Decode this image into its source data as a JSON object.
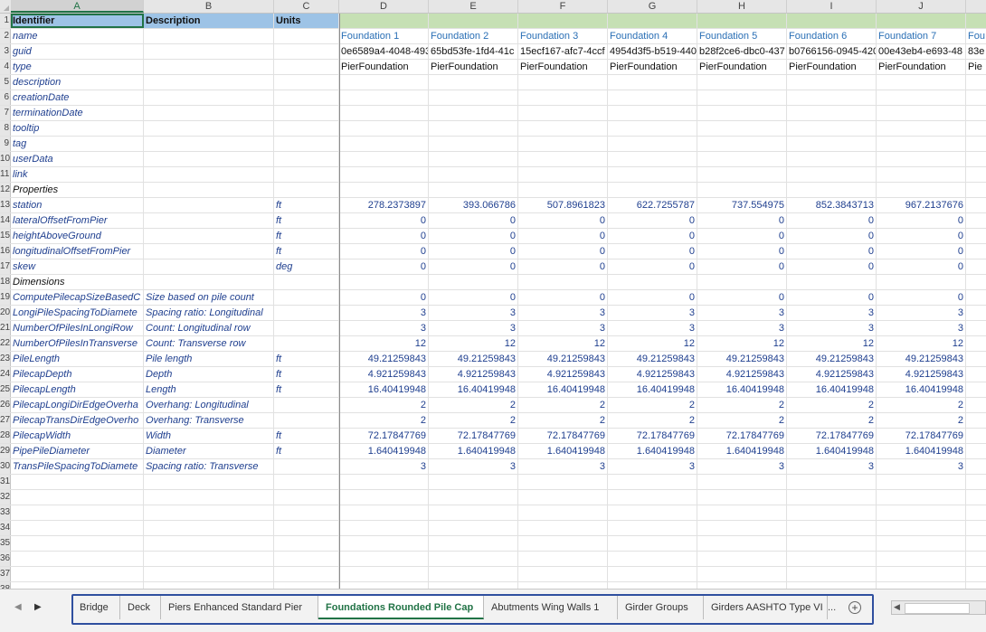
{
  "columns": [
    "A",
    "B",
    "C",
    "D",
    "E",
    "F",
    "G",
    "H",
    "I",
    "J"
  ],
  "extra_col_text": "Fou",
  "selected_cell": "A1",
  "rows": [
    {
      "n": "1",
      "a": "Identifier",
      "b": "Description",
      "c": "Units",
      "v": [
        "",
        "",
        "",
        "",
        "",
        "",
        ""
      ]
    },
    {
      "n": "2",
      "a": "name",
      "b": "",
      "c": "",
      "v": [
        "Foundation 1",
        "Foundation 2",
        "Foundation 3",
        "Foundation 4",
        "Foundation 5",
        "Foundation 6",
        "Foundation 7"
      ]
    },
    {
      "n": "3",
      "a": "guid",
      "b": "",
      "c": "",
      "v": [
        "0e6589a4-4048-493",
        "65bd53fe-1fd4-41c",
        "15ecf167-afc7-4ccf",
        "4954d3f5-b519-440",
        "b28f2ce6-dbc0-437",
        "b0766156-0945-420",
        "00e43eb4-e693-48"
      ]
    },
    {
      "n": "4",
      "a": "type",
      "b": "",
      "c": "",
      "v": [
        "PierFoundation",
        "PierFoundation",
        "PierFoundation",
        "PierFoundation",
        "PierFoundation",
        "PierFoundation",
        "PierFoundation"
      ]
    },
    {
      "n": "5",
      "a": "description",
      "b": "",
      "c": "",
      "v": [
        "",
        "",
        "",
        "",
        "",
        "",
        ""
      ]
    },
    {
      "n": "6",
      "a": "creationDate",
      "b": "",
      "c": "",
      "v": [
        "",
        "",
        "",
        "",
        "",
        "",
        ""
      ]
    },
    {
      "n": "7",
      "a": "terminationDate",
      "b": "",
      "c": "",
      "v": [
        "",
        "",
        "",
        "",
        "",
        "",
        ""
      ]
    },
    {
      "n": "8",
      "a": "tooltip",
      "b": "",
      "c": "",
      "v": [
        "",
        "",
        "",
        "",
        "",
        "",
        ""
      ]
    },
    {
      "n": "9",
      "a": "tag",
      "b": "",
      "c": "",
      "v": [
        "",
        "",
        "",
        "",
        "",
        "",
        ""
      ]
    },
    {
      "n": "10",
      "a": "userData",
      "b": "",
      "c": "",
      "v": [
        "",
        "",
        "",
        "",
        "",
        "",
        ""
      ]
    },
    {
      "n": "11",
      "a": "link",
      "b": "",
      "c": "",
      "v": [
        "",
        "",
        "",
        "",
        "",
        "",
        ""
      ]
    },
    {
      "n": "12",
      "a": "Properties",
      "b": "",
      "c": "",
      "v": [
        "",
        "",
        "",
        "",
        "",
        "",
        ""
      ]
    },
    {
      "n": "13",
      "a": "station",
      "b": "",
      "c": "ft",
      "v": [
        "278.2373897",
        "393.066786",
        "507.8961823",
        "622.7255787",
        "737.554975",
        "852.3843713",
        "967.2137676"
      ]
    },
    {
      "n": "14",
      "a": "lateralOffsetFromPier",
      "b": "",
      "c": "ft",
      "v": [
        "0",
        "0",
        "0",
        "0",
        "0",
        "0",
        "0"
      ]
    },
    {
      "n": "15",
      "a": "heightAboveGround",
      "b": "",
      "c": "ft",
      "v": [
        "0",
        "0",
        "0",
        "0",
        "0",
        "0",
        "0"
      ]
    },
    {
      "n": "16",
      "a": "longitudinalOffsetFromPier",
      "b": "",
      "c": "ft",
      "v": [
        "0",
        "0",
        "0",
        "0",
        "0",
        "0",
        "0"
      ]
    },
    {
      "n": "17",
      "a": "skew",
      "b": "",
      "c": "deg",
      "v": [
        "0",
        "0",
        "0",
        "0",
        "0",
        "0",
        "0"
      ]
    },
    {
      "n": "18",
      "a": "Dimensions",
      "b": "",
      "c": "",
      "v": [
        "",
        "",
        "",
        "",
        "",
        "",
        ""
      ]
    },
    {
      "n": "19",
      "a": "ComputePilecapSizeBasedC",
      "b": "Size based on pile count",
      "c": "",
      "v": [
        "0",
        "0",
        "0",
        "0",
        "0",
        "0",
        "0"
      ]
    },
    {
      "n": "20",
      "a": "LongiPileSpacingToDiamete",
      "b": "Spacing ratio: Longitudinal",
      "c": "",
      "v": [
        "3",
        "3",
        "3",
        "3",
        "3",
        "3",
        "3"
      ]
    },
    {
      "n": "21",
      "a": "NumberOfPilesInLongiRow",
      "b": "Count: Longitudinal row",
      "c": "",
      "v": [
        "3",
        "3",
        "3",
        "3",
        "3",
        "3",
        "3"
      ]
    },
    {
      "n": "22",
      "a": "NumberOfPilesInTransverse",
      "b": "Count: Transverse row",
      "c": "",
      "v": [
        "12",
        "12",
        "12",
        "12",
        "12",
        "12",
        "12"
      ]
    },
    {
      "n": "23",
      "a": "PileLength",
      "b": "Pile length",
      "c": "ft",
      "v": [
        "49.21259843",
        "49.21259843",
        "49.21259843",
        "49.21259843",
        "49.21259843",
        "49.21259843",
        "49.21259843"
      ]
    },
    {
      "n": "24",
      "a": "PilecapDepth",
      "b": "Depth",
      "c": "ft",
      "v": [
        "4.921259843",
        "4.921259843",
        "4.921259843",
        "4.921259843",
        "4.921259843",
        "4.921259843",
        "4.921259843"
      ]
    },
    {
      "n": "25",
      "a": "PilecapLength",
      "b": "Length",
      "c": "ft",
      "v": [
        "16.40419948",
        "16.40419948",
        "16.40419948",
        "16.40419948",
        "16.40419948",
        "16.40419948",
        "16.40419948"
      ]
    },
    {
      "n": "26",
      "a": "PilecapLongiDirEdgeOverha",
      "b": "Overhang: Longitudinal",
      "c": "",
      "v": [
        "2",
        "2",
        "2",
        "2",
        "2",
        "2",
        "2"
      ]
    },
    {
      "n": "27",
      "a": "PilecapTransDirEdgeOverho",
      "b": "Overhang: Transverse",
      "c": "",
      "v": [
        "2",
        "2",
        "2",
        "2",
        "2",
        "2",
        "2"
      ]
    },
    {
      "n": "28",
      "a": "PilecapWidth",
      "b": "Width",
      "c": "ft",
      "v": [
        "72.17847769",
        "72.17847769",
        "72.17847769",
        "72.17847769",
        "72.17847769",
        "72.17847769",
        "72.17847769"
      ]
    },
    {
      "n": "29",
      "a": "PipePileDiameter",
      "b": "Diameter",
      "c": "ft",
      "v": [
        "1.640419948",
        "1.640419948",
        "1.640419948",
        "1.640419948",
        "1.640419948",
        "1.640419948",
        "1.640419948"
      ]
    },
    {
      "n": "30",
      "a": "TransPileSpacingToDiamete",
      "b": "Spacing ratio: Transverse",
      "c": "",
      "v": [
        "3",
        "3",
        "3",
        "3",
        "3",
        "3",
        "3"
      ]
    },
    {
      "n": "31",
      "a": "",
      "b": "",
      "c": "",
      "v": [
        "",
        "",
        "",
        "",
        "",
        "",
        ""
      ]
    },
    {
      "n": "32",
      "a": "",
      "b": "",
      "c": "",
      "v": [
        "",
        "",
        "",
        "",
        "",
        "",
        ""
      ]
    },
    {
      "n": "33",
      "a": "",
      "b": "",
      "c": "",
      "v": [
        "",
        "",
        "",
        "",
        "",
        "",
        ""
      ]
    },
    {
      "n": "34",
      "a": "",
      "b": "",
      "c": "",
      "v": [
        "",
        "",
        "",
        "",
        "",
        "",
        ""
      ]
    },
    {
      "n": "35",
      "a": "",
      "b": "",
      "c": "",
      "v": [
        "",
        "",
        "",
        "",
        "",
        "",
        ""
      ]
    },
    {
      "n": "36",
      "a": "",
      "b": "",
      "c": "",
      "v": [
        "",
        "",
        "",
        "",
        "",
        "",
        ""
      ]
    },
    {
      "n": "37",
      "a": "",
      "b": "",
      "c": "",
      "v": [
        "",
        "",
        "",
        "",
        "",
        "",
        ""
      ]
    },
    {
      "n": "38",
      "a": "",
      "b": "",
      "c": "",
      "v": [
        "",
        "",
        "",
        "",
        "",
        "",
        ""
      ]
    }
  ],
  "extra_row_text": {
    "2": "Fou",
    "3": "83e",
    "4": "Pie"
  },
  "tabs": [
    "Bridge",
    "Deck",
    "Piers Enhanced Standard Pier",
    "Foundations Rounded Pile Cap",
    "Abutments Wing Walls 1",
    "Girder Groups",
    "Girders AASHTO Type VI"
  ],
  "active_tab": "Foundations Rounded Pile Cap",
  "tab_overflow": "...",
  "add_sheet_icon": "plus-circle-icon",
  "nav_prev": "◀",
  "nav_next": "▶"
}
